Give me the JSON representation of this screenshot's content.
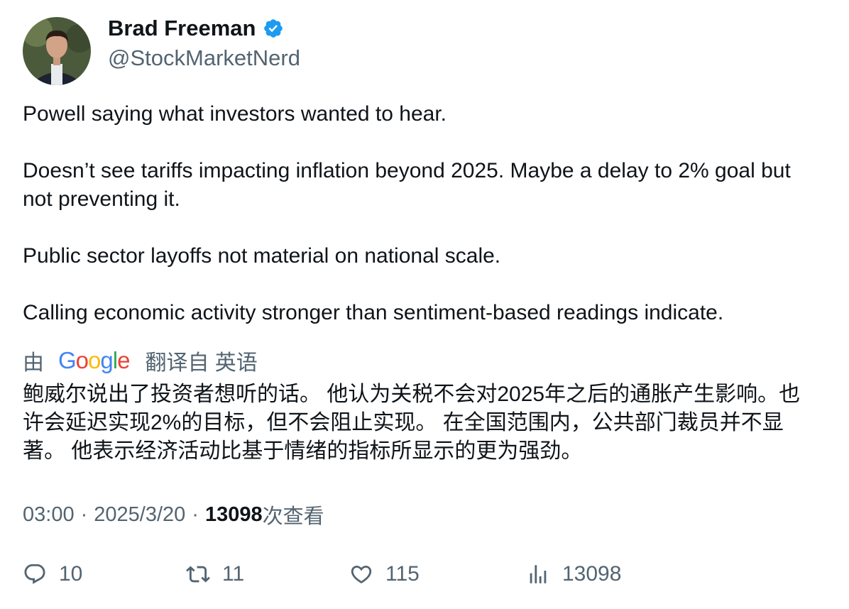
{
  "author": {
    "name": "Brad Freeman",
    "handle": "@StockMarketNerd"
  },
  "tweet": {
    "paragraphs": [
      "Powell saying what investors wanted to hear.",
      "Doesn’t see tariffs impacting inflation beyond 2025. Maybe a delay to 2% goal but not preventing it.",
      "Public sector layoffs not material on national scale.",
      "Calling economic activity stronger than sentiment-based readings indicate."
    ]
  },
  "translation": {
    "prefix": "由",
    "provider": "Google",
    "suffix": "翻译自 英语",
    "text": "鲍威尔说出了投资者想听的话。 他认为关税不会对2025年之后的通胀产生影响。也许会延迟实现2%的目标，但不会阻止实现。 在全国范围内，公共部门裁员并不显著。 他表示经济活动比基于情绪的指标所显示的更为强劲。"
  },
  "meta": {
    "time": "03:00",
    "separator": "·",
    "date": "2025/3/20",
    "views_count": "13098",
    "views_label": "次查看"
  },
  "actions": {
    "replies": "10",
    "retweets": "11",
    "likes": "115",
    "views": "13098"
  },
  "colors": {
    "text": "#0f1419",
    "secondary": "#536471",
    "verified": "#1d9bf0"
  }
}
